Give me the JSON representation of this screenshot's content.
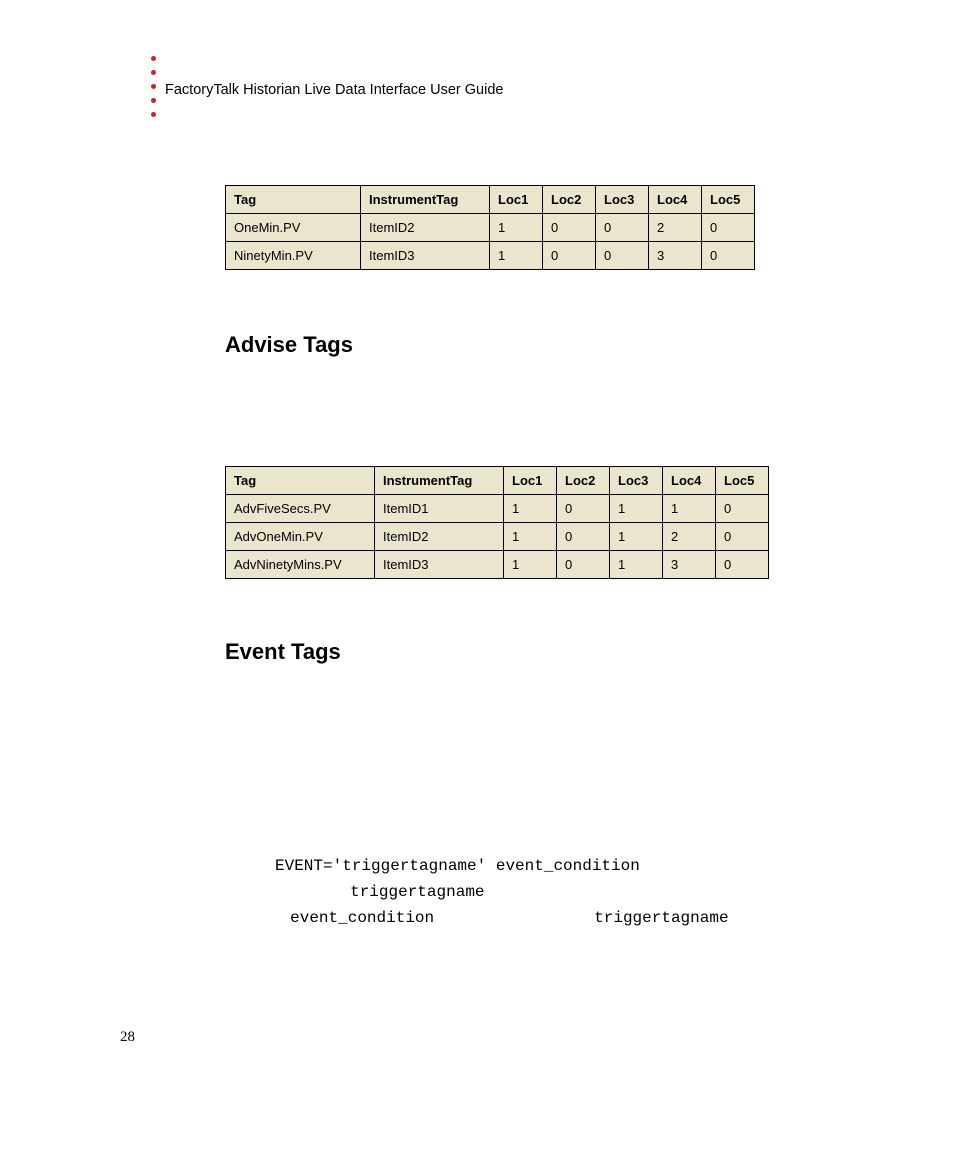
{
  "header": {
    "doc_title": "FactoryTalk Historian Live Data Interface User Guide"
  },
  "page_number": "28",
  "table1": {
    "headers": [
      "Tag",
      "InstrumentTag",
      "Loc1",
      "Loc2",
      "Loc3",
      "Loc4",
      "Loc5"
    ],
    "rows": [
      [
        "OneMin.PV",
        "ItemID2",
        "1",
        "0",
        "0",
        "2",
        "0"
      ],
      [
        "NinetyMin.PV",
        "ItemID3",
        "1",
        "0",
        "0",
        "3",
        "0"
      ]
    ]
  },
  "section1": {
    "title": "Advise Tags"
  },
  "table2": {
    "headers": [
      "Tag",
      "InstrumentTag",
      "Loc1",
      "Loc2",
      "Loc3",
      "Loc4",
      "Loc5"
    ],
    "rows": [
      [
        "AdvFiveSecs.PV",
        "ItemID1",
        "1",
        "0",
        "1",
        "1",
        "0"
      ],
      [
        "AdvOneMin.PV",
        "ItemID2",
        "1",
        "0",
        "1",
        "2",
        "0"
      ],
      [
        "AdvNinetyMins.PV",
        "ItemID3",
        "1",
        "0",
        "1",
        "3",
        "0"
      ]
    ]
  },
  "section2": {
    "title": "Event Tags"
  },
  "code": {
    "line1": "EVENT='triggertagname' event_condition",
    "frag1": "triggertagname",
    "frag2": "event_condition",
    "frag3": "triggertagname"
  }
}
